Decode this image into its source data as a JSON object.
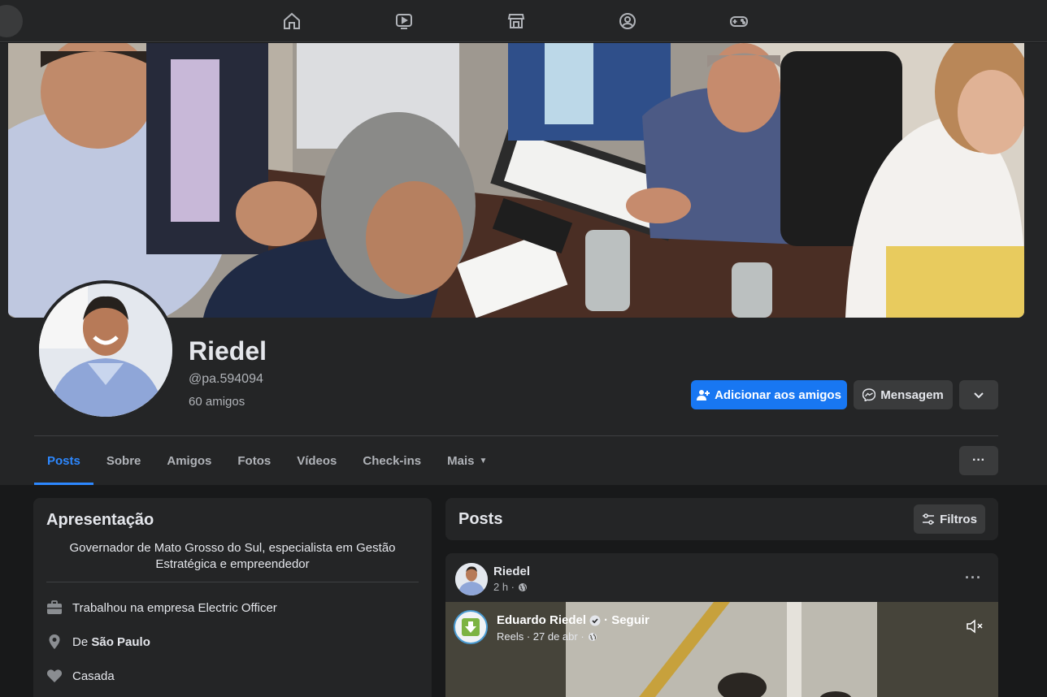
{
  "profile": {
    "name": "Riedel",
    "handle": "@pa.594094",
    "friends": "60 amigos"
  },
  "actions": {
    "add_friend": "Adicionar aos amigos",
    "message": "Mensagem"
  },
  "tabs": [
    {
      "label": "Posts"
    },
    {
      "label": "Sobre"
    },
    {
      "label": "Amigos"
    },
    {
      "label": "Fotos"
    },
    {
      "label": "Vídeos"
    },
    {
      "label": "Check-ins"
    },
    {
      "label": "Mais"
    }
  ],
  "intro": {
    "title": "Apresentação",
    "bio": "Governador de Mato Grosso do Sul, especialista em Gestão Estratégica e empreendedor",
    "work": "Trabalhou na empresa Electric Officer",
    "from_prefix": "De",
    "from_place": "São Paulo",
    "relationship": "Casada"
  },
  "posts_section": {
    "title": "Posts",
    "filter_label": "Filtros"
  },
  "post": {
    "author": "Riedel",
    "time": "2 h ·",
    "shared": {
      "author": "Eduardo Riedel",
      "follow": "· Seguir",
      "meta": "Reels · 27 de abr ·"
    }
  },
  "colors": {
    "background": "#18191a",
    "card": "#242526",
    "accent": "#2d88ff",
    "primary_button": "#1877f2"
  }
}
